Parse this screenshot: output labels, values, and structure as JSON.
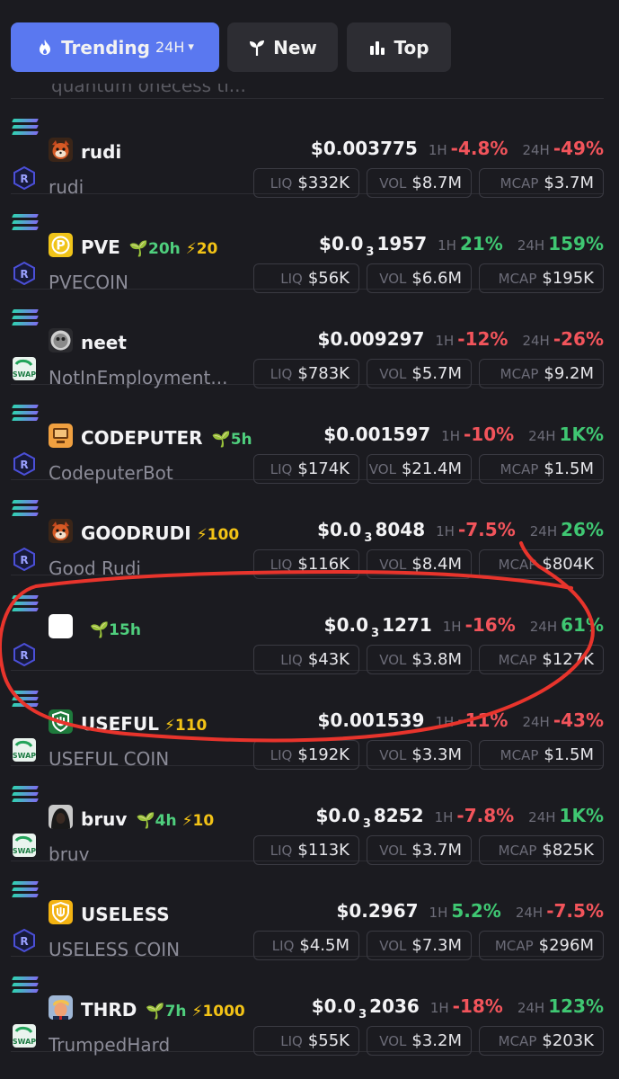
{
  "tabs": [
    {
      "label": "Trending",
      "sub": "24H",
      "icon": "flame-icon",
      "active": true
    },
    {
      "label": "New",
      "icon": "sprout-icon"
    },
    {
      "label": "Top",
      "icon": "bar-chart-icon"
    }
  ],
  "partial_row": {
    "text": "quantum onecess ti..."
  },
  "labels": {
    "h1": "1H",
    "h24": "24H",
    "liq": "LIQ",
    "vol": "VOL",
    "mcap": "MCAP"
  },
  "tokens": [
    {
      "symbol": "rudi",
      "name": "rudi",
      "dex": "raydium",
      "logo": "red-panda",
      "price_pre": "$0.003775",
      "price_sub": "",
      "price_post": "",
      "h1": "-4.8%",
      "h24": "-49%",
      "liq": "$332K",
      "vol": "$8.7M",
      "mcap": "$3.7M",
      "age": "",
      "boost": ""
    },
    {
      "symbol": "PVE",
      "name": "PVECOIN",
      "dex": "raydium",
      "logo": "gold-p",
      "price_pre": "$0.0",
      "price_sub": "3",
      "price_post": "1957",
      "h1": "21%",
      "h24": "159%",
      "liq": "$56K",
      "vol": "$6.6M",
      "mcap": "$195K",
      "age": "20h",
      "boost": "20"
    },
    {
      "symbol": "neet",
      "name": "NotInEmployment...",
      "dex": "swap",
      "logo": "grey-face",
      "price_pre": "$0.009297",
      "price_sub": "",
      "price_post": "",
      "h1": "-12%",
      "h24": "-26%",
      "liq": "$783K",
      "vol": "$5.7M",
      "mcap": "$9.2M",
      "age": "",
      "boost": ""
    },
    {
      "symbol": "CODEPUTER",
      "name": "CodeputerBot",
      "dex": "raydium",
      "logo": "orange-computer",
      "price_pre": "$0.001597",
      "price_sub": "",
      "price_post": "",
      "h1": "-10%",
      "h24": "1K%",
      "liq": "$174K",
      "vol": "$21.4M",
      "mcap": "$1.5M",
      "age": "5h",
      "boost": ""
    },
    {
      "symbol": "GOODRUDI",
      "name": "Good Rudi",
      "dex": "raydium",
      "logo": "red-panda",
      "price_pre": "$0.0",
      "price_sub": "3",
      "price_post": "8048",
      "h1": "-7.5%",
      "h24": "26%",
      "liq": "$116K",
      "vol": "$8.4M",
      "mcap": "$804K",
      "age": "",
      "boost": "100"
    },
    {
      "symbol": "",
      "name": "",
      "dex": "raydium",
      "logo": "white-square",
      "price_pre": "$0.0",
      "price_sub": "3",
      "price_post": "1271",
      "h1": "-16%",
      "h24": "61%",
      "liq": "$43K",
      "vol": "$3.8M",
      "mcap": "$127K",
      "age": "15h",
      "boost": ""
    },
    {
      "symbol": "USEFUL",
      "name": "USEFUL COIN",
      "dex": "swap",
      "logo": "green-shield",
      "price_pre": "$0.001539",
      "price_sub": "",
      "price_post": "",
      "h1": "-11%",
      "h24": "-43%",
      "liq": "$192K",
      "vol": "$3.3M",
      "mcap": "$1.5M",
      "age": "",
      "boost": "110"
    },
    {
      "symbol": "bruv",
      "name": "bruv",
      "dex": "swap",
      "logo": "hooded-figure",
      "price_pre": "$0.0",
      "price_sub": "3",
      "price_post": "8252",
      "h1": "-7.8%",
      "h24": "1K%",
      "liq": "$113K",
      "vol": "$3.7M",
      "mcap": "$825K",
      "age": "4h",
      "boost": "10"
    },
    {
      "symbol": "USELESS",
      "name": "USELESS COIN",
      "dex": "raydium",
      "logo": "gold-shield",
      "price_pre": "$0.2967",
      "price_sub": "",
      "price_post": "",
      "h1": "5.2%",
      "h24": "-7.5%",
      "liq": "$4.5M",
      "vol": "$7.3M",
      "mcap": "$296M",
      "age": "",
      "boost": ""
    },
    {
      "symbol": "THRD",
      "name": "TrumpedHard",
      "dex": "swap",
      "logo": "trump-face",
      "price_pre": "$0.0",
      "price_sub": "3",
      "price_post": "2036",
      "h1": "-18%",
      "h24": "123%",
      "liq": "$55K",
      "vol": "$3.2M",
      "mcap": "$203K",
      "age": "7h",
      "boost": "1000"
    }
  ],
  "colors": {
    "accent": "#5a78f0",
    "positive": "#3fc772",
    "negative": "#f2545b",
    "boost": "#f3c316",
    "annotation": "#e8342c"
  }
}
